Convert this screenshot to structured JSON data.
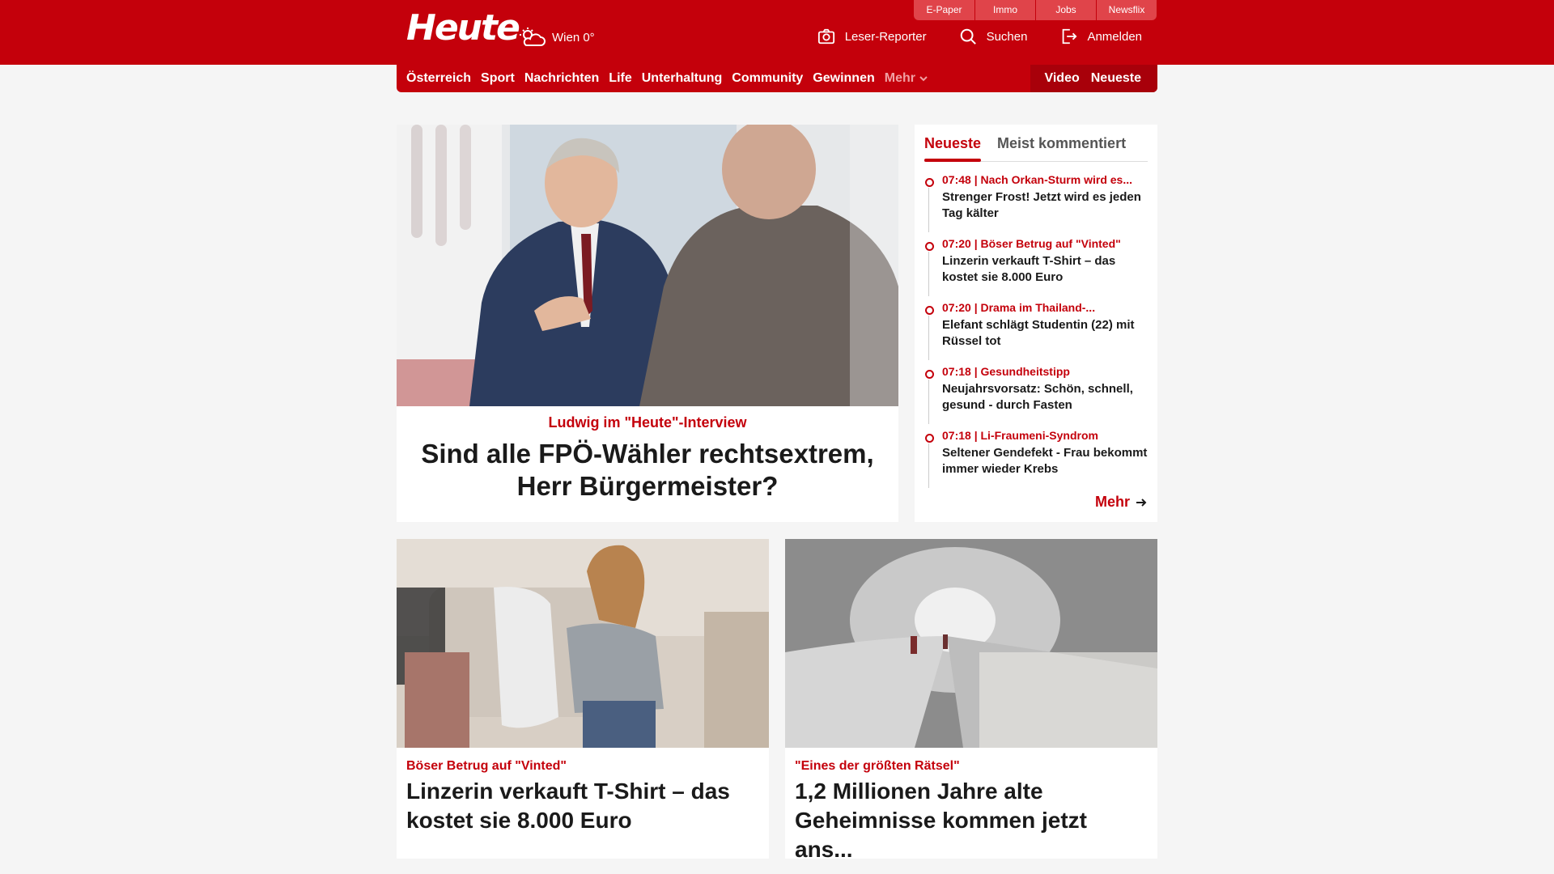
{
  "header": {
    "logo": "Heute",
    "weather": "Wien 0°",
    "services": [
      "E-Paper",
      "Immo",
      "Jobs",
      "Newsflix"
    ],
    "actions": {
      "reporter": "Leser-Reporter",
      "search": "Suchen",
      "login": "Anmelden"
    }
  },
  "nav": {
    "items": [
      "Österreich",
      "Sport",
      "Nachrichten",
      "Life",
      "Unterhaltung",
      "Community",
      "Gewinnen"
    ],
    "more": "Mehr",
    "video": "Video",
    "latest": "Neueste"
  },
  "hero": {
    "kicker": "Ludwig im \"Heute\"-Interview",
    "title": "Sind alle FPÖ-Wähler rechtsextrem, Herr Bürgermeister?"
  },
  "sidebar": {
    "tabs": [
      "Neueste",
      "Meist kommentiert"
    ],
    "items": [
      {
        "meta": "07:48 | Nach Orkan-Sturm wird es...",
        "headline": "Strenger Frost! Jetzt wird es jeden Tag kälter"
      },
      {
        "meta": "07:20 | Böser Betrug auf \"Vinted\"",
        "headline": "Linzerin verkauft T-Shirt – das kostet sie 8.000 Euro"
      },
      {
        "meta": "07:20 | Drama im Thailand-...",
        "headline": "Elefant schlägt Studentin (22) mit Rüssel tot"
      },
      {
        "meta": "07:18 | Gesundheitstipp",
        "headline": "Neujahrsvorsatz: Schön, schnell, gesund - durch Fasten"
      },
      {
        "meta": "07:18 | Li-Fraumeni-Syndrom",
        "headline": "Seltener Gendefekt - Frau bekommt immer wieder Krebs"
      }
    ],
    "more": "Mehr"
  },
  "cards": [
    {
      "kicker": "Böser Betrug auf \"Vinted\"",
      "title": "Linzerin verkauft T-Shirt – das kostet sie 8.000 Euro"
    },
    {
      "kicker": "\"Eines der größten Rätsel\"",
      "title": "1,2 Millionen Jahre alte Geheimnisse kommen jetzt ans..."
    }
  ],
  "colors": {
    "brand": "#c4000b",
    "background": "#f5f5f5"
  }
}
